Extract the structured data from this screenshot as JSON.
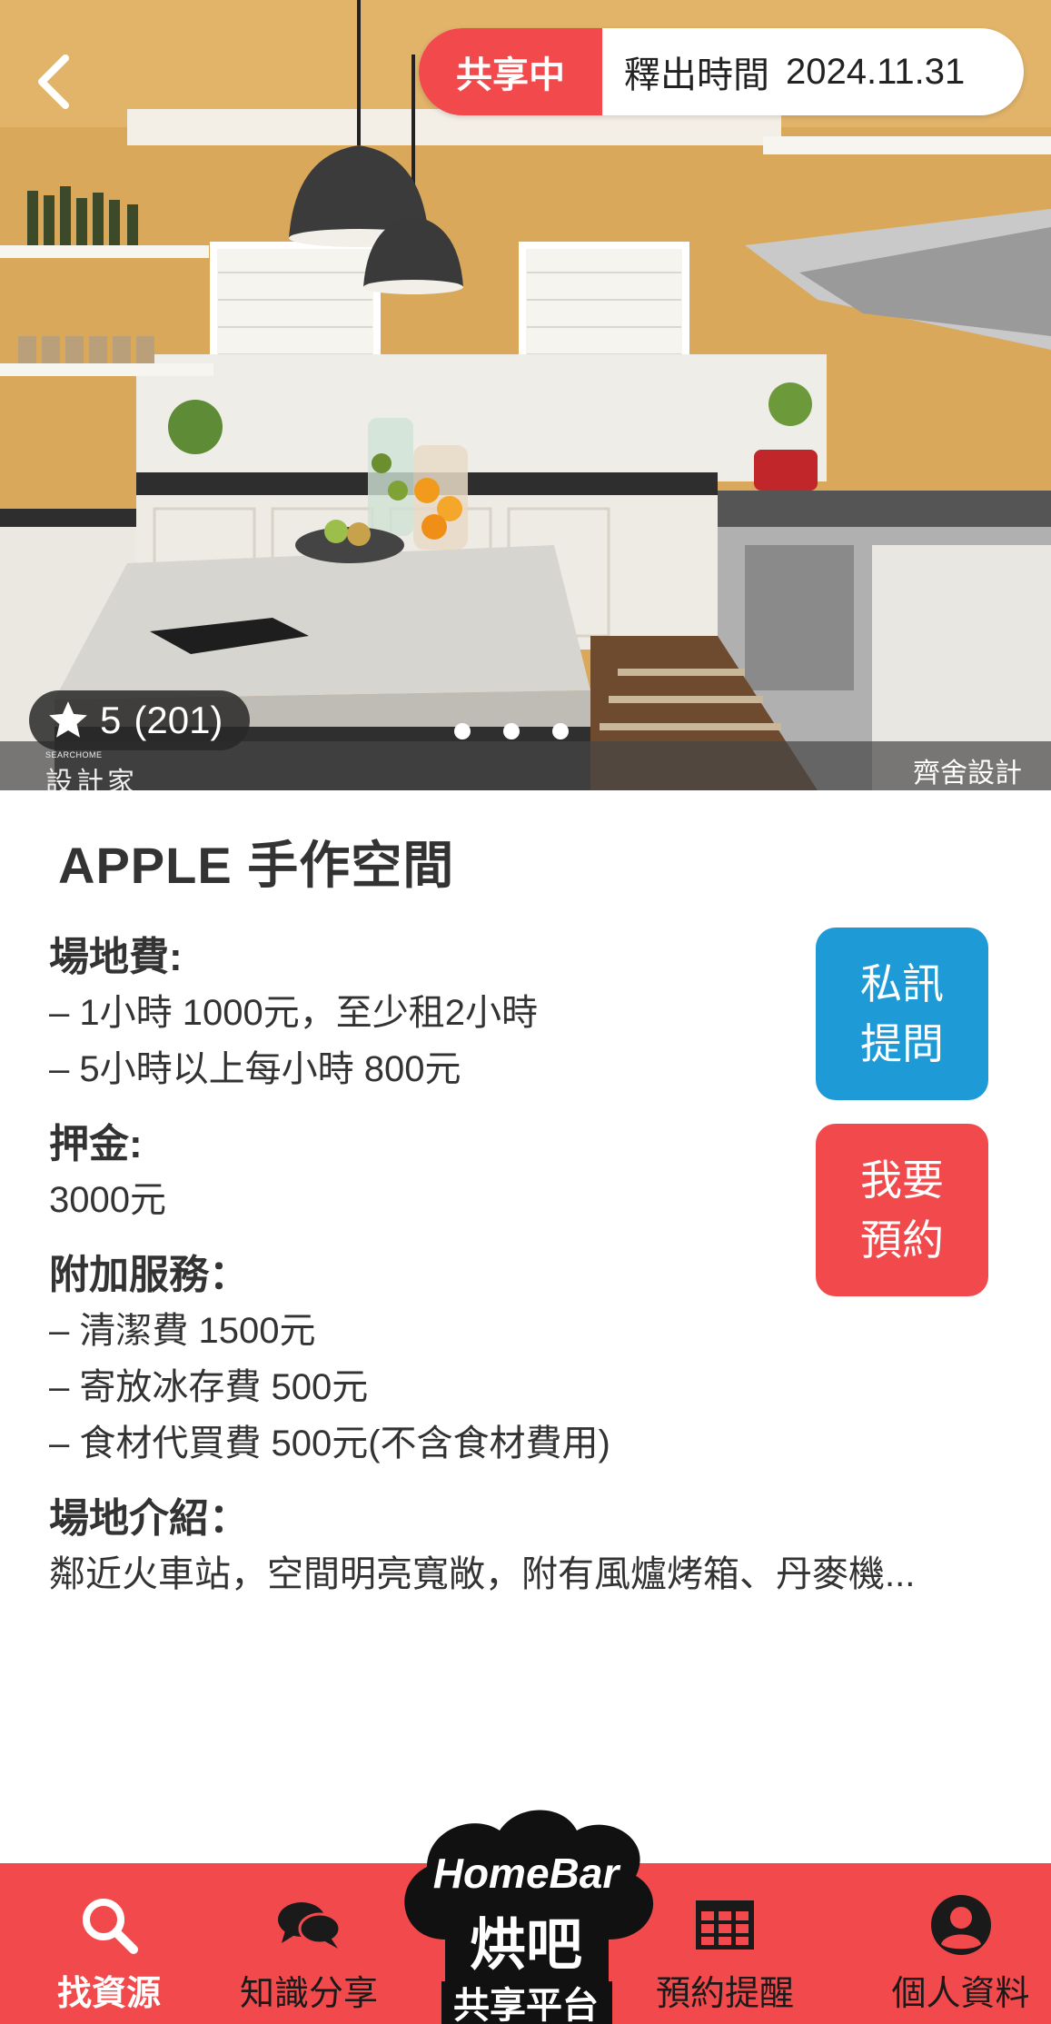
{
  "status": {
    "badge": "共享中",
    "release_label": "釋出時間",
    "release_date": "2024.11.31"
  },
  "rating": {
    "score": "5",
    "count": "(201)",
    "stars_value": 5
  },
  "carousel": {
    "total_dots": 3
  },
  "photo": {
    "watermark_small": "SEARCHOME",
    "watermark_large": "設計家",
    "credit": "齊舍設計"
  },
  "venue": {
    "title": "APPLE 手作空間",
    "fee": {
      "heading": "場地費:",
      "lines": [
        "– 1小時 1000元，至少租2小時",
        "– 5小時以上每小時 800元"
      ]
    },
    "deposit": {
      "heading": "押金:",
      "value": "3000元"
    },
    "services": {
      "heading": "附加服務：",
      "lines": [
        "– 清潔費 1500元",
        "– 寄放冰存費 500元",
        "– 食材代買費 500元(不含食材費用)"
      ]
    },
    "intro": {
      "heading": "場地介紹：",
      "text": "鄰近火車站，空間明亮寬敞，附有風爐烤箱、丹麥機..."
    }
  },
  "actions": {
    "message_line1": "私訊",
    "message_line2": "提問",
    "book_line1": "我要",
    "book_line2": "預約"
  },
  "nav": {
    "search": {
      "label": "找資源",
      "icon": "search-icon"
    },
    "knowledge": {
      "label": "知識分享",
      "icon": "chat-bubbles-icon"
    },
    "center": {
      "brand_en": "HomeBar",
      "brand_zh": "烘吧",
      "label": "共享平台"
    },
    "reserve": {
      "label": "預約提醒",
      "icon": "calendar-grid-icon"
    },
    "profile": {
      "label": "個人資料",
      "icon": "user-icon"
    }
  },
  "colors": {
    "accent_red": "#f24a4c",
    "accent_blue": "#1e9bd7",
    "text": "#333333"
  }
}
